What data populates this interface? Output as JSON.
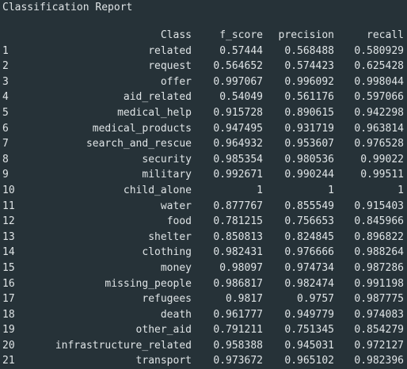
{
  "report": {
    "title": "Classification Report",
    "columns": {
      "class": "Class",
      "f_score": "f_score",
      "precision": "precision",
      "recall": "recall"
    },
    "rows": [
      {
        "index": "1",
        "class": "related",
        "f_score": "0.57444",
        "precision": "0.568488",
        "recall": "0.580929"
      },
      {
        "index": "2",
        "class": "request",
        "f_score": "0.564652",
        "precision": "0.574423",
        "recall": "0.625428"
      },
      {
        "index": "3",
        "class": "offer",
        "f_score": "0.997067",
        "precision": "0.996092",
        "recall": "0.998044"
      },
      {
        "index": "4",
        "class": "aid_related",
        "f_score": "0.54049",
        "precision": "0.561176",
        "recall": "0.597066"
      },
      {
        "index": "5",
        "class": "medical_help",
        "f_score": "0.915728",
        "precision": "0.890615",
        "recall": "0.942298"
      },
      {
        "index": "6",
        "class": "medical_products",
        "f_score": "0.947495",
        "precision": "0.931719",
        "recall": "0.963814"
      },
      {
        "index": "7",
        "class": "search_and_rescue",
        "f_score": "0.964932",
        "precision": "0.953607",
        "recall": "0.976528"
      },
      {
        "index": "8",
        "class": "security",
        "f_score": "0.985354",
        "precision": "0.980536",
        "recall": "0.99022"
      },
      {
        "index": "9",
        "class": "military",
        "f_score": "0.992671",
        "precision": "0.990244",
        "recall": "0.99511"
      },
      {
        "index": "10",
        "class": "child_alone",
        "f_score": "1",
        "precision": "1",
        "recall": "1"
      },
      {
        "index": "11",
        "class": "water",
        "f_score": "0.877767",
        "precision": "0.855549",
        "recall": "0.915403"
      },
      {
        "index": "12",
        "class": "food",
        "f_score": "0.781215",
        "precision": "0.756653",
        "recall": "0.845966"
      },
      {
        "index": "13",
        "class": "shelter",
        "f_score": "0.850813",
        "precision": "0.824845",
        "recall": "0.896822"
      },
      {
        "index": "14",
        "class": "clothing",
        "f_score": "0.982431",
        "precision": "0.976666",
        "recall": "0.988264"
      },
      {
        "index": "15",
        "class": "money",
        "f_score": "0.98097",
        "precision": "0.974734",
        "recall": "0.987286"
      },
      {
        "index": "16",
        "class": "missing_people",
        "f_score": "0.986817",
        "precision": "0.982474",
        "recall": "0.991198"
      },
      {
        "index": "17",
        "class": "refugees",
        "f_score": "0.9817",
        "precision": "0.9757",
        "recall": "0.987775"
      },
      {
        "index": "18",
        "class": "death",
        "f_score": "0.961777",
        "precision": "0.949779",
        "recall": "0.974083"
      },
      {
        "index": "19",
        "class": "other_aid",
        "f_score": "0.791211",
        "precision": "0.751345",
        "recall": "0.854279"
      },
      {
        "index": "20",
        "class": "infrastructure_related",
        "f_score": "0.958388",
        "precision": "0.945031",
        "recall": "0.972127"
      },
      {
        "index": "21",
        "class": "transport",
        "f_score": "0.973672",
        "precision": "0.965102",
        "recall": "0.982396"
      }
    ]
  },
  "colors": {
    "background": "#263238",
    "text": "#dfe4e6"
  }
}
